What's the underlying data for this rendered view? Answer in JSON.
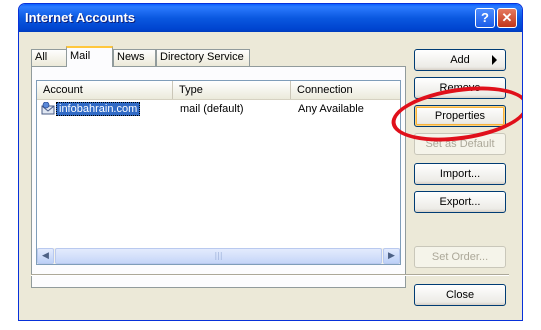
{
  "window": {
    "title": "Internet Accounts"
  },
  "titlebar": {
    "help_glyph": "?",
    "close_glyph": "✕"
  },
  "tabs": [
    "All",
    "Mail",
    "News",
    "Directory Service"
  ],
  "active_tab": "Mail",
  "list": {
    "columns": [
      "Account",
      "Type",
      "Connection"
    ],
    "rows": [
      {
        "account": "infobahrain.com",
        "type": "mail (default)",
        "connection": "Any Available",
        "icon": "mail-account-icon"
      }
    ]
  },
  "scrollbar": {
    "left_glyph": "◀",
    "right_glyph": "▶",
    "thumb_grip": "|||"
  },
  "buttons": {
    "add": "Add",
    "remove": "Remove",
    "properties": "Properties",
    "set_default": "Set as Default",
    "import": "Import...",
    "export": "Export...",
    "set_order": "Set Order...",
    "close": "Close"
  },
  "colors": {
    "title_bar": "#0a58e0",
    "selection": "#316ac5",
    "highlight_circle": "#e0101b"
  }
}
